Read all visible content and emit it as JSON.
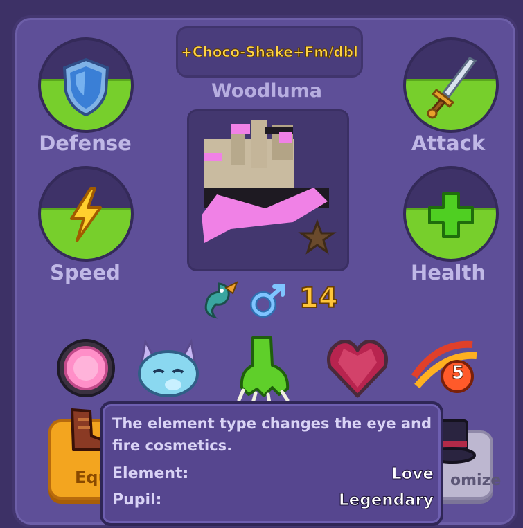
{
  "dragon": {
    "nickname": "+Choco-Shake+Fm/dbl",
    "species": "Woodluma",
    "level": "14"
  },
  "stats": {
    "defense": {
      "label": "Defense",
      "level_percent": 55
    },
    "attack": {
      "label": "Attack",
      "level_percent": 55
    },
    "speed": {
      "label": "Speed",
      "level_percent": 55
    },
    "health": {
      "label": "Health",
      "level_percent": 55
    }
  },
  "badges": {
    "dna_count": "5"
  },
  "buttons": {
    "equip_label": "Equ",
    "customize_label": "omize"
  },
  "tooltip": {
    "description": "The element type changes the eye and fire cosmetics.",
    "element_label": "Element:",
    "element_value": "Love",
    "pupil_label": "Pupil:",
    "pupil_value": "Legendary"
  },
  "colors": {
    "panel": "#5e4f98",
    "stat_fill": "#77cf2c",
    "gold": "#ffd447",
    "level": "#ffc53a"
  },
  "icons": [
    "shield-icon",
    "sword-icon",
    "lightning-icon",
    "plus-icon",
    "dragon-species-icon",
    "male-gender-icon",
    "pink-orb-icon",
    "dragon-face-icon",
    "green-claw-icon",
    "heart-gem-icon",
    "dna-icon",
    "boots-icon",
    "top-hat-icon",
    "star-icon"
  ]
}
